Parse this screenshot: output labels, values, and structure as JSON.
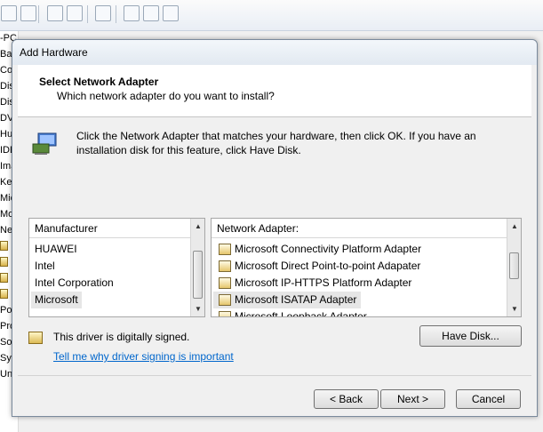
{
  "background": {
    "tree_labels": [
      "-PC",
      "Bat",
      "Cor",
      "Dis",
      "Dis",
      "DVI",
      "Hu",
      "IDE",
      "Ima",
      "Key",
      "Mic",
      "Mo",
      "Net",
      "",
      "",
      "",
      "",
      "Por",
      "Pro",
      "Sou",
      "Sys",
      "Uni"
    ]
  },
  "dialog": {
    "title": "Add Hardware",
    "header_title": "Select Network Adapter",
    "header_subtitle": "Which network adapter do you want to install?",
    "instructions": "Click the Network Adapter that matches your hardware, then click OK. If you have an installation disk for this feature, click Have Disk.",
    "manufacturer": {
      "header": "Manufacturer",
      "items": [
        "HUAWEI",
        "Intel",
        "Intel Corporation",
        "Microsoft"
      ],
      "selected": "Microsoft"
    },
    "adapters": {
      "header": "Network Adapter:",
      "items": [
        "Microsoft Connectivity Platform Adapter",
        "Microsoft Direct Point-to-point Adapater",
        "Microsoft IP-HTTPS Platform Adapter",
        "Microsoft ISATAP Adapter",
        "Microsoft Loopback Adapter"
      ],
      "selected": "Microsoft ISATAP Adapter"
    },
    "signed_text": "This driver is digitally signed.",
    "signing_link": "Tell me why driver signing is important",
    "have_disk_label": "Have Disk...",
    "back_label": "< Back",
    "next_label": "Next >",
    "cancel_label": "Cancel"
  },
  "colors": {
    "link": "#0066cc",
    "selection": "#e6e6e6"
  }
}
